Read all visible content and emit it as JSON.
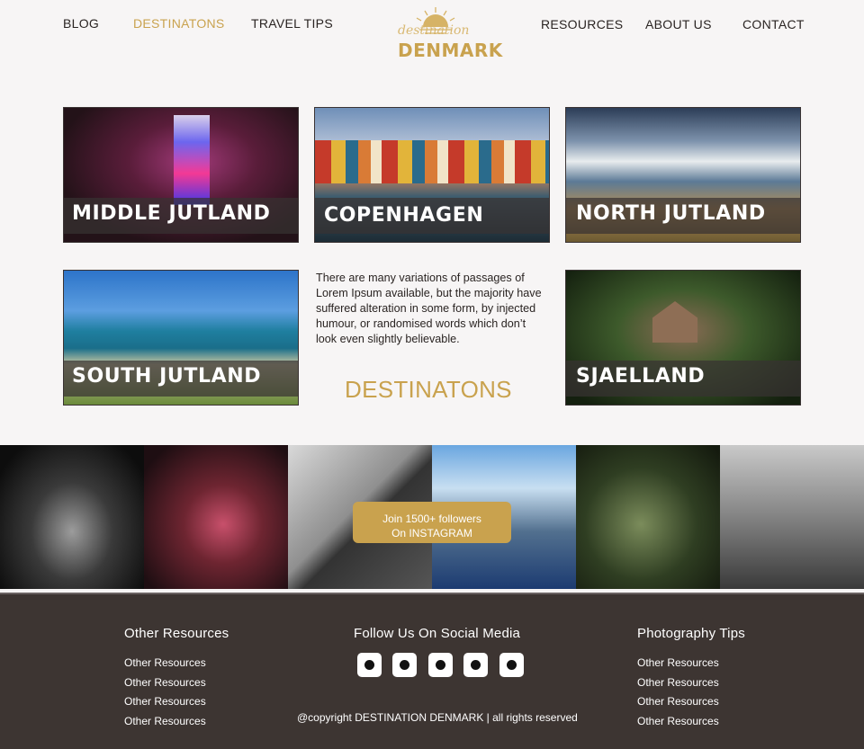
{
  "nav": {
    "left": [
      "BLOG",
      "DESTINATONS",
      "TRAVEL TIPS"
    ],
    "right": [
      "RESOURCES",
      "ABOUT US",
      "CONTACT"
    ],
    "active": "DESTINATONS",
    "accent_color": "#c9a24e"
  },
  "logo": {
    "script": "destination",
    "main": "DENMARK",
    "icon": "sun-icon"
  },
  "tiles": [
    {
      "label": "MIDDLE JUTLAND"
    },
    {
      "label": "COPENHAGEN"
    },
    {
      "label": "NORTH JUTLAND"
    },
    {
      "label": "SOUTH JUTLAND"
    },
    {
      "label": "SJAELLAND"
    }
  ],
  "blurb": "There are many variations of passages of Lorem Ipsum available, but the majority have suffered alteration in some form, by injected humour, or randomised words which don’t look even slightly believable.",
  "section_title": "DESTINATONS",
  "instagram": {
    "line1": "Join 1500+ followers",
    "line2": "On INSTAGRAM"
  },
  "footer": {
    "left_title": "Other Resources",
    "left_items": [
      "Other Resources",
      "Other Resources",
      "Other Resources",
      "Other Resources"
    ],
    "center_title": "Follow Us On Social Media",
    "social_icons": [
      "social-icon-1",
      "social-icon-2",
      "social-icon-3",
      "social-icon-4",
      "social-icon-5"
    ],
    "copyright": "@copyright DESTINATION DENMARK | all rights reserved",
    "right_title": "Photography Tips",
    "right_items": [
      "Other Resources",
      "Other Resources",
      "Other Resources",
      "Other Resources"
    ],
    "bg_color": "#3d3532"
  }
}
